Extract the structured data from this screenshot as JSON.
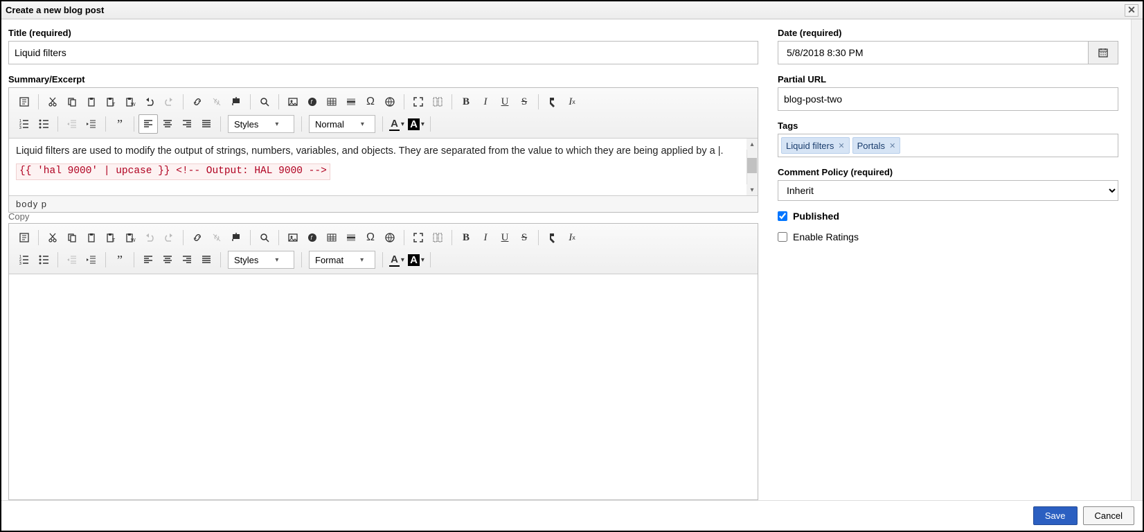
{
  "window": {
    "title": "Create a new blog post"
  },
  "form": {
    "title_label": "Title (required)",
    "title_value": "Liquid filters",
    "summary_label": "Summary/Excerpt",
    "copy_label": "Copy",
    "date_label": "Date (required)",
    "date_value": "5/8/2018 8:30 PM",
    "partial_url_label": "Partial URL",
    "partial_url_value": "blog-post-two",
    "tags_label": "Tags",
    "tags": [
      "Liquid filters",
      "Portals"
    ],
    "comment_policy_label": "Comment Policy (required)",
    "comment_policy_value": "Inherit",
    "published_label": "Published",
    "published_checked": true,
    "enable_ratings_label": "Enable Ratings",
    "enable_ratings_checked": false
  },
  "editor1": {
    "styles_label": "Styles",
    "format_label": "Normal",
    "content_text": "Liquid filters are used to modify the output of strings, numbers, variables, and objects. They are separated from the value to which they are being applied by a |.",
    "content_code": "{{ 'hal 9000' | upcase }} <!-- Output: HAL 9000 -->",
    "pathbar": "body  p"
  },
  "editor2": {
    "styles_label": "Styles",
    "format_label": "Format"
  },
  "buttons": {
    "save": "Save",
    "cancel": "Cancel"
  }
}
